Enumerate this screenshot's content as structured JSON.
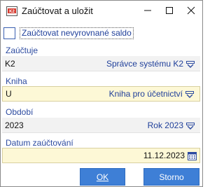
{
  "window": {
    "title": "Zaúčtovat a uložit"
  },
  "options": {
    "unbalanced_label": "Zaúčtovat nevyrovnané saldo",
    "unbalanced_checked": false
  },
  "zauctuje": {
    "label": "Zaúčtuje",
    "code": "K2",
    "value": "Správce systému K2"
  },
  "kniha": {
    "label": "Kniha",
    "code": "U",
    "value": "Kniha pro účetnictví"
  },
  "obdobi": {
    "label": "Období",
    "code": "2023",
    "value": "Rok 2023"
  },
  "datum": {
    "label": "Datum zaúčtování",
    "value": "11.12.2023"
  },
  "buttons": {
    "ok_label": "OK",
    "storno_label": "Storno"
  },
  "colors": {
    "accent": "#3e7fd6",
    "label_blue": "#2d4ba0",
    "value_blue": "#1f3f9a",
    "required_field_bg": "#fdf8d6"
  },
  "icons": {
    "app": "k2-app-icon",
    "minimize": "minimize-icon",
    "maximize": "maximize-icon",
    "close": "close-icon",
    "dropdown": "chevron-down-icon",
    "calendar": "calendar-icon"
  }
}
